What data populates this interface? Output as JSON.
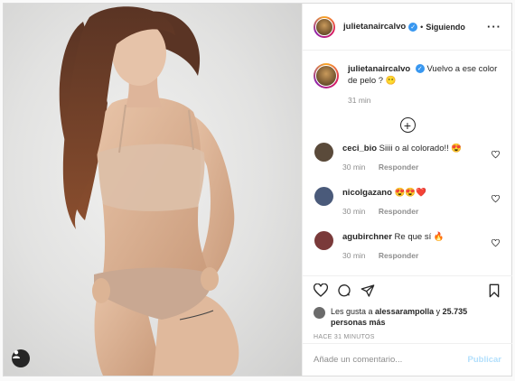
{
  "post": {
    "username": "julietanaircalvo",
    "follow_separator": "•",
    "follow_status": "Siguiendo",
    "more_glyph": "···"
  },
  "caption": {
    "username": "julietanaircalvo",
    "text": "Vuelvo a ese color de pelo ? 😶",
    "time": "31 min"
  },
  "load_more_glyph": "+",
  "comments": [
    {
      "username": "ceci_bio",
      "text": "Siiii o al colorado!! 😍",
      "time": "30 min",
      "reply": "Responder",
      "avatar_color": "#5a4a3a"
    },
    {
      "username": "nicolgazano",
      "text": "😍😍❤️",
      "time": "30 min",
      "reply": "Responder",
      "avatar_color": "#4a5a7a"
    },
    {
      "username": "agubirchner",
      "text": "Re que sí 🔥",
      "time": "30 min",
      "reply": "Responder",
      "avatar_color": "#7a3a3a"
    }
  ],
  "likes": {
    "prefix": "Les gusta a ",
    "user": "alessarampolla",
    "middle": " y ",
    "count": "25.735 personas más"
  },
  "time_ago": "HACE 31 MINUTOS",
  "comment_box": {
    "placeholder": "Añade un comentario...",
    "publish": "Publicar"
  },
  "colors": {
    "verified": "#3897f0",
    "publish_disabled": "#b2dffc",
    "secondary_text": "#8e8e8e"
  }
}
